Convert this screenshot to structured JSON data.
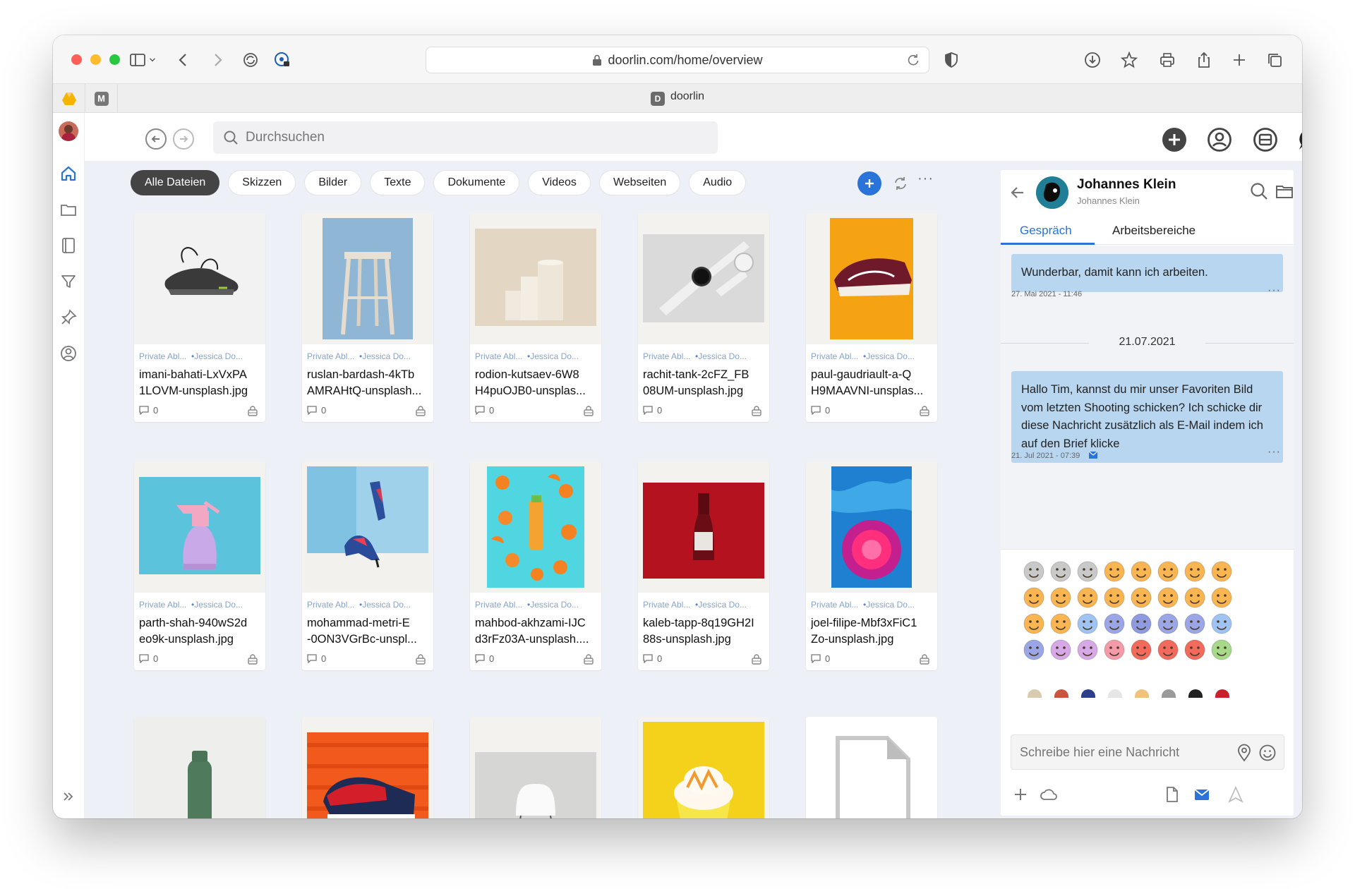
{
  "browser": {
    "url": "doorlin.com/home/overview",
    "tab_title": "doorlin",
    "tab_favicon": "D",
    "pinned_tab_letter": "M"
  },
  "app": {
    "search_placeholder": "Durchsuchen",
    "filters": [
      "Alle Dateien",
      "Skizzen",
      "Bilder",
      "Texte",
      "Dokumente",
      "Videos",
      "Webseiten",
      "Audio"
    ],
    "active_filter": "Alle Dateien",
    "accent": "#2a73d9",
    "cards": [
      {
        "owner": "Private Abl...",
        "author": "Jessica Do...",
        "name1": "imani-bahati-LxVxPA",
        "name2": "1LOVM-unsplash.jpg",
        "comments": "0",
        "thumb": "sneaker-black"
      },
      {
        "owner": "Private Abl...",
        "author": "Jessica Do...",
        "name1": "ruslan-bardash-4kTb",
        "name2": "AMRAHtQ-unsplash...",
        "comments": "0",
        "thumb": "stool"
      },
      {
        "owner": "Private Abl...",
        "author": "Jessica Do...",
        "name1": "rodion-kutsaev-6W8",
        "name2": "H4puOJB0-unsplas...",
        "comments": "0",
        "thumb": "cylinders"
      },
      {
        "owner": "Private Abl...",
        "author": "Jessica Do...",
        "name1": "rachit-tank-2cFZ_FB",
        "name2": "08UM-unsplash.jpg",
        "comments": "0",
        "thumb": "watch"
      },
      {
        "owner": "Private Abl...",
        "author": "Jessica Do...",
        "name1": "paul-gaudriault-a-Q",
        "name2": "H9MAAVNI-unsplas...",
        "comments": "0",
        "thumb": "sneaker-red"
      },
      {
        "owner": "Private Abl...",
        "author": "Jessica Do...",
        "name1": "parth-shah-940wS2d",
        "name2": "eo9k-unsplash.jpg",
        "comments": "0",
        "thumb": "spray"
      },
      {
        "owner": "Private Abl...",
        "author": "Jessica Do...",
        "name1": "mohammad-metri-E",
        "name2": "-0ON3VGrBc-unspl...",
        "comments": "0",
        "thumb": "heels"
      },
      {
        "owner": "Private Abl...",
        "author": "Jessica Do...",
        "name1": "mahbod-akhzami-IJC",
        "name2": "d3rFz03A-unsplash....",
        "comments": "0",
        "thumb": "oranges"
      },
      {
        "owner": "Private Abl...",
        "author": "Jessica Do...",
        "name1": "kaleb-tapp-8q19GH2I",
        "name2": "88s-unsplash.jpg",
        "comments": "0",
        "thumb": "bottle"
      },
      {
        "owner": "Private Abl...",
        "author": "Jessica Do...",
        "name1": "joel-filipe-Mbf3xFiC1",
        "name2": "Zo-unsplash.jpg",
        "comments": "0",
        "thumb": "abstract"
      }
    ]
  },
  "chat": {
    "name": "Johannes Klein",
    "subtitle": "Johannes Klein",
    "tabs": [
      "Gespräch",
      "Arbeitsbereiche"
    ],
    "msg1": "Wunderbar, damit kann ich arbeiten.",
    "msg1_time": "27. Mai 2021 - 11:46",
    "date_sep": "21.07.2021",
    "msg2": "Hallo Tim, kannst du mir unser Favoriten Bild vom letzten Shooting schicken? Ich schicke dir diese Nachricht zusätzlich als E-Mail indem ich auf den Brief klicke",
    "msg2_time": "21. Jul 2021 - 07:39",
    "input_placeholder": "Schreibe hier eine Nachricht"
  }
}
